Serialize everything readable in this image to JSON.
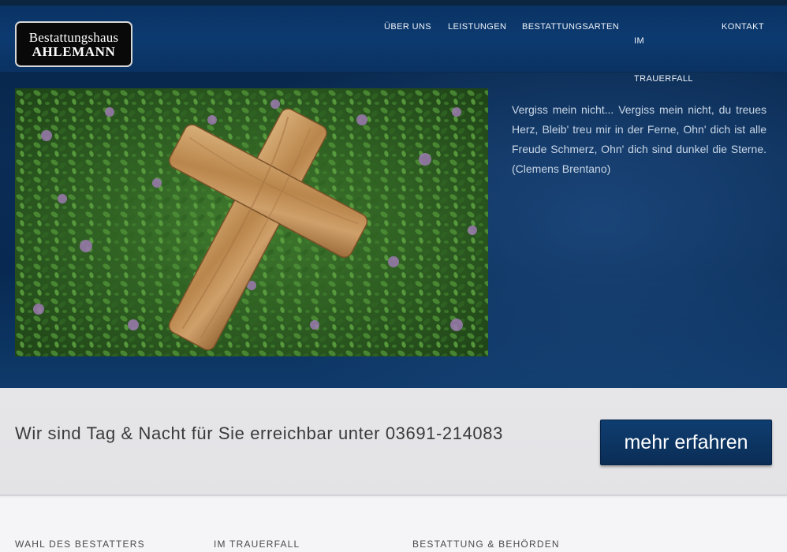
{
  "brand": {
    "line1": "Bestattungshaus",
    "line2": "AHLEMANN"
  },
  "nav": {
    "ueber_uns": "ÜBER UNS",
    "leistungen": "LEISTUNGEN",
    "bestattungsarten": "BESTATTUNGSARTEN",
    "im_trauerfall": "IM TRAUERFALL",
    "kontakt": "KONTAKT"
  },
  "hero": {
    "quote": "Vergiss mein nicht... Vergiss mein nicht, du treues Herz, Bleib' treu mir in der Ferne, Ohn' dich ist alle Freude Schmerz, Ohn' dich sind dunkel die Sterne. (Clemens Brentano)"
  },
  "cta": {
    "text": "Wir sind Tag & Nacht für Sie erreichbar unter 03691-214083",
    "button": "mehr erfahren"
  },
  "footer": {
    "col1": "WAHL DES BESTATTERS",
    "col2": "IM TRAUERFALL",
    "col3": "BESTATTUNG & BEHÖRDEN"
  },
  "colors": {
    "navy": "#0a3364",
    "button": "#0f3d70"
  }
}
